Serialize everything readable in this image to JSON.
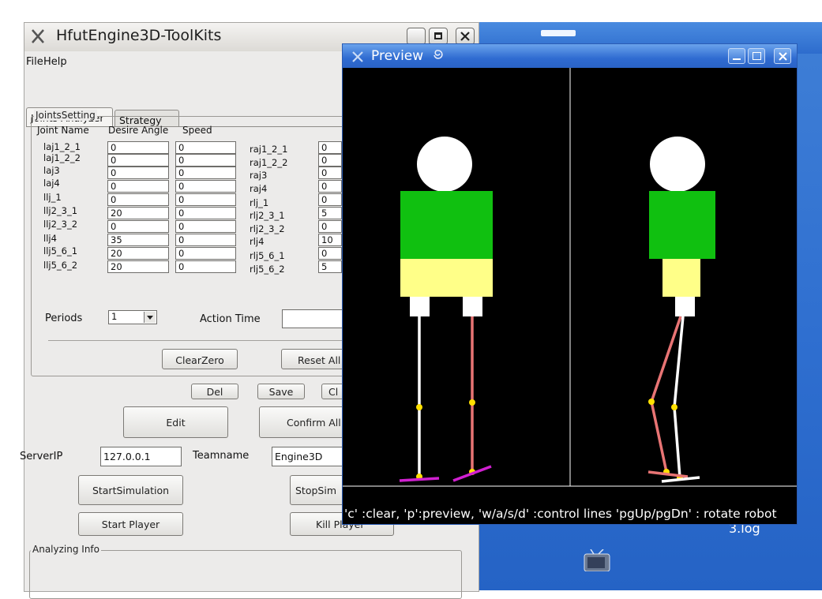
{
  "desktop": {
    "icon_label": "3.log"
  },
  "main_window": {
    "title": "HfutEngine3D-ToolKits",
    "menu": [
      "File",
      "Help"
    ],
    "tabs": [
      "Joints Analyzer",
      "Strategy"
    ],
    "joints_group_title": "JointsSetting",
    "headers": {
      "name": "Joint Name",
      "angle": "Desire Angle",
      "speed": "Speed"
    },
    "left_joints": [
      {
        "name": "laj1_2_1",
        "angle": "0",
        "speed": "0"
      },
      {
        "name": "laj1_2_2",
        "angle": "0",
        "speed": "0"
      },
      {
        "name": "laj3",
        "angle": "0",
        "speed": "0"
      },
      {
        "name": "laj4",
        "angle": "0",
        "speed": "0"
      },
      {
        "name": "llj_1",
        "angle": "0",
        "speed": "0"
      },
      {
        "name": "llj2_3_1",
        "angle": "20",
        "speed": "0"
      },
      {
        "name": "llj2_3_2",
        "angle": "0",
        "speed": "0"
      },
      {
        "name": "llj4",
        "angle": "35",
        "speed": "0"
      },
      {
        "name": "llj5_6_1",
        "angle": "20",
        "speed": "0"
      },
      {
        "name": "llj5_6_2",
        "angle": "20",
        "speed": "0"
      }
    ],
    "right_joints": [
      {
        "name": "raj1_2_1",
        "angle": "0"
      },
      {
        "name": "raj1_2_2",
        "angle": "0"
      },
      {
        "name": "raj3",
        "angle": "0"
      },
      {
        "name": "raj4",
        "angle": "0"
      },
      {
        "name": "rlj_1",
        "angle": "0"
      },
      {
        "name": "rlj2_3_1",
        "angle": "5"
      },
      {
        "name": "rlj2_3_2",
        "angle": "0"
      },
      {
        "name": "rlj4",
        "angle": "10"
      },
      {
        "name": "rlj5_6_1",
        "angle": "0"
      },
      {
        "name": "rlj5_6_2",
        "angle": "5"
      }
    ],
    "periods_label": "Periods",
    "periods_value": "1",
    "action_time_label": "Action Time",
    "action_time_value": "",
    "buttons": {
      "clear_zero": "ClearZero",
      "reset_all": "Reset All",
      "del": "Del",
      "save": "Save",
      "cl": "Cl",
      "edit": "Edit",
      "confirm_all": "Confirm All",
      "start_simulation": "StartSimulation",
      "stop_simulation": "StopSim",
      "start_player": "Start Player",
      "kill_player": "Kill Player"
    },
    "server_ip_label": "ServerIP",
    "server_ip_value": "127.0.0.1",
    "teamname_label": "Teamname",
    "teamname_value": "Engine3D",
    "analyzing_group_title": "Analyzing Info"
  },
  "preview_window": {
    "title": "Preview",
    "hint": "'c' :clear, 'p':preview, 'w/a/s/d' :control lines 'pgUp/pgDn' : rotate robot"
  },
  "colors": {
    "torso": "#10c010",
    "hip": "#ffff88",
    "left_leg": "#ffffff",
    "right_leg": "#e87474",
    "joint": "#ffe000",
    "foot": "#d020d0",
    "title_blue": "#2f6bd1"
  }
}
